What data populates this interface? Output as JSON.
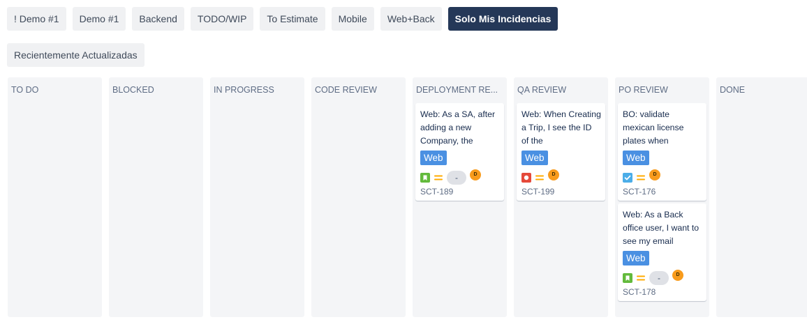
{
  "filters": [
    {
      "label": "! Demo #1",
      "active": false
    },
    {
      "label": "Demo #1",
      "active": false
    },
    {
      "label": "Backend",
      "active": false
    },
    {
      "label": "TODO/WIP",
      "active": false
    },
    {
      "label": "To Estimate",
      "active": false
    },
    {
      "label": "Mobile",
      "active": false
    },
    {
      "label": "Web+Back",
      "active": false
    },
    {
      "label": "Solo Mis Incidencias",
      "active": true
    },
    {
      "label": "Recientemente Actualizadas",
      "active": false
    }
  ],
  "columns": [
    {
      "title": "TO DO",
      "cards": []
    },
    {
      "title": "BLOCKED",
      "cards": []
    },
    {
      "title": "IN PROGRESS",
      "cards": []
    },
    {
      "title": "CODE REVIEW",
      "cards": []
    },
    {
      "title": "DEPLOYMENT RE...",
      "cards": [
        {
          "summary": "Web: As a SA, after adding a new Company, the",
          "tag": "Web",
          "type_icon": "story-icon",
          "type_color": "#63ba3c",
          "priority_icon": "priority-medium-icon",
          "estimate": "-",
          "avatar_initial": "D",
          "key": "SCT-189"
        }
      ]
    },
    {
      "title": "QA REVIEW",
      "cards": [
        {
          "summary": "Web: When Creating a Trip, I see the ID of the",
          "tag": "Web",
          "type_icon": "bug-icon",
          "type_color": "#e5493a",
          "priority_icon": "priority-medium-icon",
          "estimate": "",
          "avatar_initial": "D",
          "key": "SCT-199"
        }
      ]
    },
    {
      "title": "PO REVIEW",
      "cards": [
        {
          "summary": "BO: validate mexican license plates when",
          "tag": "Web",
          "type_icon": "task-icon",
          "type_color": "#4bade8",
          "priority_icon": "priority-medium-icon",
          "estimate": "",
          "avatar_initial": "D",
          "key": "SCT-176"
        },
        {
          "summary": "Web: As a Back office user, I want to see my email",
          "tag": "Web",
          "type_icon": "story-icon",
          "type_color": "#63ba3c",
          "priority_icon": "priority-medium-icon",
          "estimate": "-",
          "avatar_initial": "D",
          "key": "SCT-178"
        }
      ]
    },
    {
      "title": "DONE",
      "cards": []
    }
  ],
  "colors": {
    "priority_medium": "#ffab00",
    "avatar": "#f89b1c",
    "tag": "#4a90e2",
    "active_filter": "#253858"
  }
}
